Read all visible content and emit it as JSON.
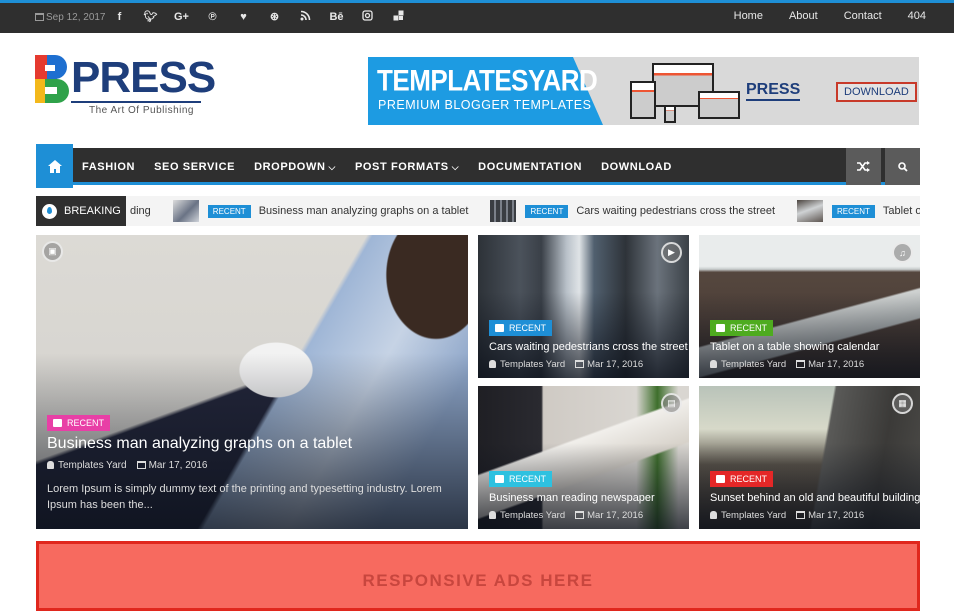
{
  "topbar": {
    "date": "Sep 12, 2017",
    "social_icons": [
      {
        "name": "facebook-icon",
        "glyph": "f"
      },
      {
        "name": "twitter-icon",
        "glyph": "🐦"
      },
      {
        "name": "google-plus-icon",
        "glyph": "G+"
      },
      {
        "name": "pinterest-icon",
        "glyph": "℗"
      },
      {
        "name": "heart-icon",
        "glyph": "♥"
      },
      {
        "name": "dribbble-icon",
        "glyph": "⊛"
      },
      {
        "name": "rss-icon",
        "glyph": "◝"
      },
      {
        "name": "behance-icon",
        "glyph": "Bē"
      },
      {
        "name": "instagram-icon",
        "glyph": "◙"
      },
      {
        "name": "delicious-icon",
        "glyph": "◪"
      }
    ],
    "nav": [
      "Home",
      "About",
      "Contact",
      "404"
    ]
  },
  "logo": {
    "word": "PRESS",
    "tagline": "The Art Of Publishing"
  },
  "banner": {
    "title": "TEMPLATESYARD",
    "subtitle": "PREMIUM BLOGGER TEMPLATES",
    "brand": "PRESS",
    "cta": "DOWNLOAD"
  },
  "mainnav": {
    "items": [
      {
        "label": "FASHION",
        "dropdown": false
      },
      {
        "label": "SEO SERVICE",
        "dropdown": false
      },
      {
        "label": "DROPDOWN",
        "dropdown": true
      },
      {
        "label": "POST FORMATS",
        "dropdown": true
      },
      {
        "label": "DOCUMENTATION",
        "dropdown": false
      },
      {
        "label": "DOWNLOAD",
        "dropdown": false
      }
    ],
    "chevron": "⌄",
    "shuffle_glyph": "⤨",
    "home_glyph": "⌂"
  },
  "breaking": {
    "label": "BREAKING",
    "tail": "ding",
    "items": [
      {
        "badge": "RECENT",
        "text": "Business man analyzing graphs on a tablet"
      },
      {
        "badge": "RECENT",
        "text": "Cars waiting pedestrians cross the street"
      },
      {
        "badge": "RECENT",
        "text": "Tablet on a ta"
      }
    ]
  },
  "featured": {
    "big": {
      "category": "RECENT",
      "category_color": "#e83fa6",
      "title": "Business man analyzing graphs on a tablet",
      "author": "Templates Yard",
      "date": "Mar 17, 2016",
      "excerpt": "Lorem Ipsum is simply dummy text of the printing and typesetting industry. Lorem Ipsum has been the..."
    },
    "small": [
      {
        "category": "RECENT",
        "category_color": "#1e8fd6",
        "title": "Cars waiting pedestrians cross the street",
        "author": "Templates Yard",
        "date": "Mar 17, 2016",
        "format": "video"
      },
      {
        "category": "RECENT",
        "category_color": "#4eab1f",
        "title": "Tablet on a table showing calendar",
        "author": "Templates Yard",
        "date": "Mar 17, 2016",
        "format": "audio"
      },
      {
        "category": "RECENT",
        "category_color": "#2ec1e0",
        "title": "Business man reading newspaper",
        "author": "Templates Yard",
        "date": "Mar 17, 2016",
        "format": "standard"
      },
      {
        "category": "RECENT",
        "category_color": "#e42727",
        "title": "Sunset behind an old and beautiful building",
        "author": "Templates Yard",
        "date": "Mar 17, 2016",
        "format": "gallery"
      }
    ]
  },
  "ads": {
    "text": "RESPONSIVE ADS HERE"
  },
  "colors": {
    "accent": "#1e8fd6",
    "dark": "#2f2f2f",
    "ads_bg": "#f76a5f"
  }
}
